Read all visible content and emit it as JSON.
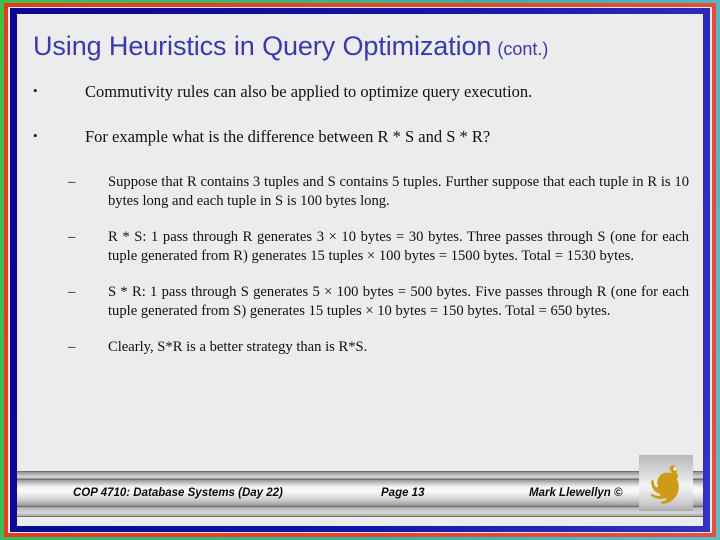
{
  "slide": {
    "title": "Using Heuristics in Query Optimization",
    "title_suffix": "(cont.)",
    "title_color": "#3a3aad",
    "bullet_marker": "•",
    "dash_marker": "–",
    "bullets": [
      {
        "level": 1,
        "text": "Commutivity rules can also be applied to optimize query execution."
      },
      {
        "level": 1,
        "text": "For example what is the difference between R * S and S * R?"
      },
      {
        "level": 2,
        "text": "Suppose that R contains 3 tuples and S contains 5 tuples.  Further suppose that each tuple in R is 10 bytes long and each tuple in S is 100 bytes long."
      },
      {
        "level": 2,
        "text": "R * S: 1 pass through R generates 3 × 10 bytes = 30 bytes.  Three passes through S (one for each tuple generated from R) generates 15 tuples × 100 bytes = 1500 bytes.  Total = 1530 bytes."
      },
      {
        "level": 2,
        "text": "S * R: 1 pass through S generates 5 × 100 bytes = 500 bytes.  Five passes through R (one for each tuple generated from S) generates 15 tuples × 10 bytes = 150 bytes.  Total = 650 bytes."
      },
      {
        "level": 2,
        "text": "Clearly, S*R is a better strategy than is R*S."
      }
    ]
  },
  "footer": {
    "course": "COP 4710: Database Systems  (Day 22)",
    "page": "Page 13",
    "author": "Mark Llewellyn ©",
    "logo_name": "ucf-pegasus-logo",
    "logo_color": "#cf9a16"
  },
  "frame": {
    "outer_color": "#3fbf4a",
    "accent_color": "#e8402a",
    "inner_color": "#0b0b9e",
    "canvas_color": "#ececec"
  }
}
